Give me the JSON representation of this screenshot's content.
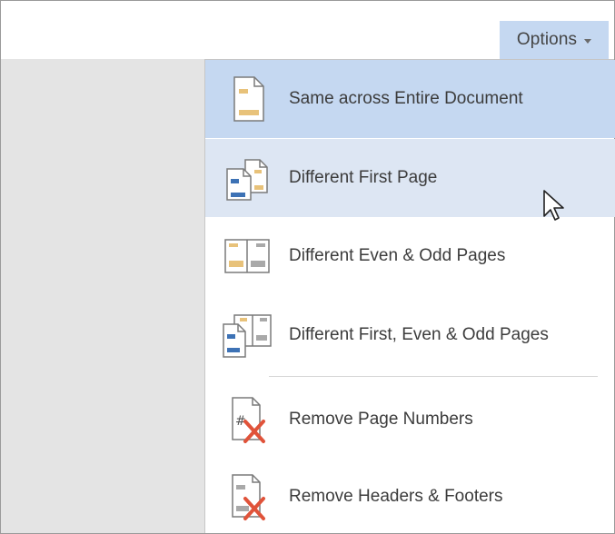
{
  "toolbar": {
    "options_label": "Options",
    "options_caret_icon": "chevron-down-icon"
  },
  "menu": {
    "items": [
      {
        "label": "Same across Entire Document",
        "icon": "single-page-header-icon",
        "state": "selected"
      },
      {
        "label": "Different First Page",
        "icon": "different-first-page-icon",
        "state": "hover"
      },
      {
        "label": "Different Even & Odd Pages",
        "icon": "even-odd-pages-icon",
        "state": "normal"
      },
      {
        "label": "Different First, Even & Odd Pages",
        "icon": "first-even-odd-pages-icon",
        "state": "normal"
      },
      {
        "label": "Remove Page Numbers",
        "icon": "remove-page-numbers-icon",
        "state": "normal"
      },
      {
        "label": "Remove Headers & Footers",
        "icon": "remove-headers-footers-icon",
        "state": "normal"
      }
    ]
  },
  "colors": {
    "selected_bg": "#c5d8f1",
    "hover_bg": "#dde6f3",
    "doc_gray": "#e4e4e4",
    "header_gold": "#e8c27a",
    "header_blue": "#3d72b5",
    "header_gray": "#a9a9a9",
    "remove_red": "#e0533a"
  }
}
